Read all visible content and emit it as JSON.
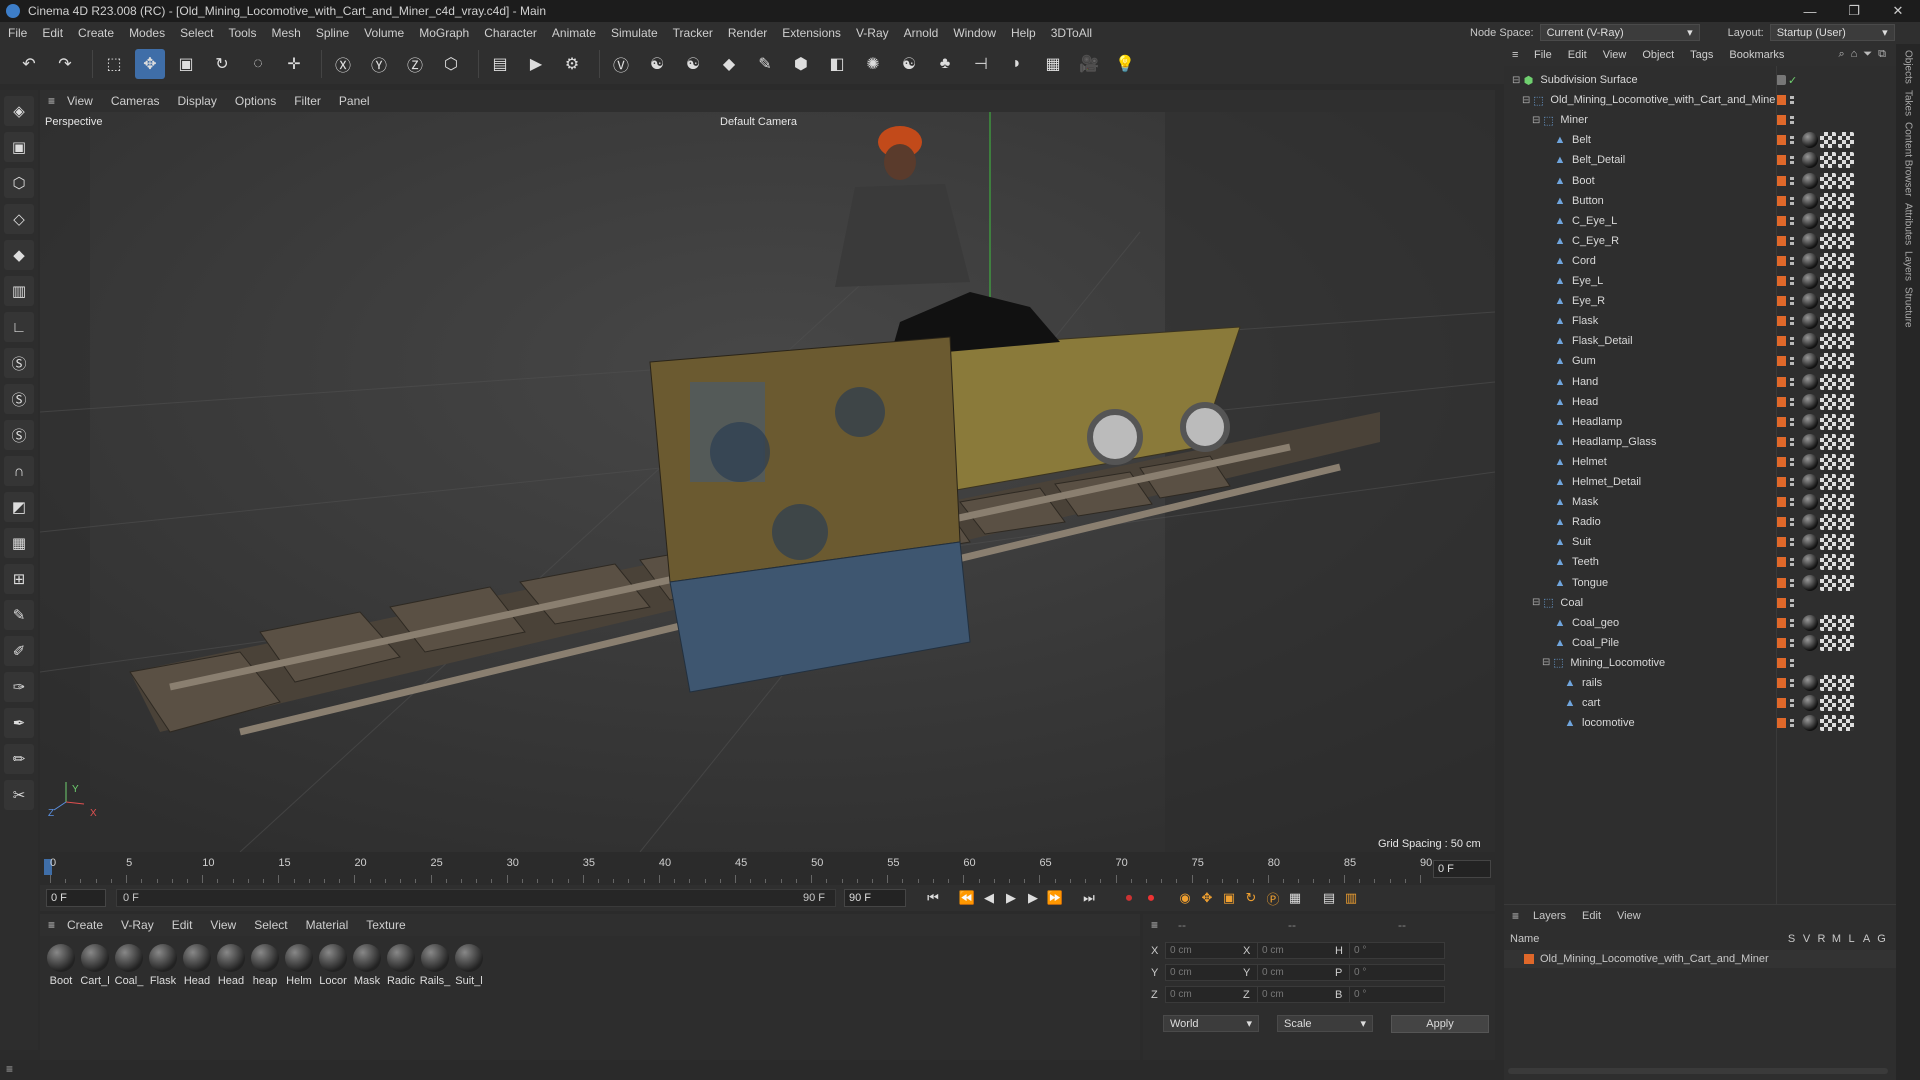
{
  "window": {
    "title": "Cinema 4D R23.008 (RC) - [Old_Mining_Locomotive_with_Cart_and_Miner_c4d_vray.c4d] - Main",
    "controls": [
      "—",
      "❐",
      "✕"
    ]
  },
  "menubar": [
    "File",
    "Edit",
    "Create",
    "Modes",
    "Select",
    "Tools",
    "Mesh",
    "Spline",
    "Volume",
    "MoGraph",
    "Character",
    "Animate",
    "Simulate",
    "Tracker",
    "Render",
    "Extensions",
    "V-Ray",
    "Arnold",
    "Window",
    "Help",
    "3DToAll"
  ],
  "nodespace": {
    "label": "Node Space:",
    "value": "Current (V-Ray)",
    "layout_label": "Layout:",
    "layout_value": "Startup (User)"
  },
  "toolbar": {
    "icons": [
      "undo-icon",
      "redo-icon",
      "select-icon",
      "move-icon",
      "scale-icon",
      "rotate-icon",
      "free-icon",
      "add-icon",
      "x-axis-icon",
      "y-axis-icon",
      "z-axis-icon",
      "coord-icon",
      "render-region-icon",
      "render-view-icon",
      "render-settings-icon",
      "vray-icon",
      "python-icon",
      "python-icon",
      "cube-icon",
      "pen-icon",
      "subdivision-icon",
      "extrude-icon",
      "array-icon",
      "python-icon",
      "mograph-icon",
      "deformer-icon",
      "sweep-icon",
      "floor-icon",
      "camera-icon",
      "light-icon"
    ]
  },
  "viewport": {
    "menu": [
      "View",
      "Cameras",
      "Display",
      "Options",
      "Filter",
      "Panel"
    ],
    "label": "Perspective",
    "camera": "Default Camera",
    "grid_spacing": "Grid Spacing : 50 cm",
    "axes": {
      "x": "X",
      "y": "Y",
      "z": "Z"
    }
  },
  "timeline": {
    "ticks": [
      "0",
      "5",
      "10",
      "15",
      "20",
      "25",
      "30",
      "35",
      "40",
      "45",
      "50",
      "55",
      "60",
      "65",
      "70",
      "75",
      "80",
      "85",
      "90"
    ],
    "end_field": "0 F"
  },
  "transport": {
    "start": "0 F",
    "current": "0 F",
    "end": "90 F",
    "max": "90 F"
  },
  "material_panel": {
    "menu": [
      "Create",
      "V-Ray",
      "Edit",
      "View",
      "Select",
      "Material",
      "Texture"
    ],
    "materials": [
      "Boot",
      "Cart_l",
      "Coal_",
      "Flask",
      "Head",
      "Head",
      "heap",
      "Helm",
      "Locor",
      "Mask",
      "Radic",
      "Rails_",
      "Suit_l"
    ]
  },
  "attributes": {
    "header": [
      "--",
      "--",
      "--"
    ],
    "rows": [
      {
        "l1": "X",
        "v1": "0 cm",
        "l2": "X",
        "v2": "0 cm",
        "l3": "H",
        "v3": "0 °"
      },
      {
        "l1": "Y",
        "v1": "0 cm",
        "l2": "Y",
        "v2": "0 cm",
        "l3": "P",
        "v3": "0 °"
      },
      {
        "l1": "Z",
        "v1": "0 cm",
        "l2": "Z",
        "v2": "0 cm",
        "l3": "B",
        "v3": "0 °"
      }
    ],
    "world": "World",
    "scale": "Scale",
    "apply": "Apply"
  },
  "object_panel": {
    "menu": [
      "File",
      "Edit",
      "View",
      "Object",
      "Tags",
      "Bookmarks"
    ],
    "objects": [
      {
        "name": "Subdivision Surface",
        "indent": 0,
        "kind": "sub"
      },
      {
        "name": "Old_Mining_Locomotive_with_Cart_and_Miner",
        "indent": 1,
        "kind": "null"
      },
      {
        "name": "Miner",
        "indent": 2,
        "kind": "null"
      },
      {
        "name": "Belt",
        "indent": 3,
        "kind": "obj"
      },
      {
        "name": "Belt_Detail",
        "indent": 3,
        "kind": "obj"
      },
      {
        "name": "Boot",
        "indent": 3,
        "kind": "obj"
      },
      {
        "name": "Button",
        "indent": 3,
        "kind": "obj"
      },
      {
        "name": "C_Eye_L",
        "indent": 3,
        "kind": "obj"
      },
      {
        "name": "C_Eye_R",
        "indent": 3,
        "kind": "obj"
      },
      {
        "name": "Cord",
        "indent": 3,
        "kind": "obj"
      },
      {
        "name": "Eye_L",
        "indent": 3,
        "kind": "obj"
      },
      {
        "name": "Eye_R",
        "indent": 3,
        "kind": "obj"
      },
      {
        "name": "Flask",
        "indent": 3,
        "kind": "obj"
      },
      {
        "name": "Flask_Detail",
        "indent": 3,
        "kind": "obj"
      },
      {
        "name": "Gum",
        "indent": 3,
        "kind": "obj"
      },
      {
        "name": "Hand",
        "indent": 3,
        "kind": "obj"
      },
      {
        "name": "Head",
        "indent": 3,
        "kind": "obj"
      },
      {
        "name": "Headlamp",
        "indent": 3,
        "kind": "obj"
      },
      {
        "name": "Headlamp_Glass",
        "indent": 3,
        "kind": "obj"
      },
      {
        "name": "Helmet",
        "indent": 3,
        "kind": "obj"
      },
      {
        "name": "Helmet_Detail",
        "indent": 3,
        "kind": "obj"
      },
      {
        "name": "Mask",
        "indent": 3,
        "kind": "obj"
      },
      {
        "name": "Radio",
        "indent": 3,
        "kind": "obj"
      },
      {
        "name": "Suit",
        "indent": 3,
        "kind": "obj"
      },
      {
        "name": "Teeth",
        "indent": 3,
        "kind": "obj"
      },
      {
        "name": "Tongue",
        "indent": 3,
        "kind": "obj"
      },
      {
        "name": "Coal",
        "indent": 2,
        "kind": "null"
      },
      {
        "name": "Coal_geo",
        "indent": 3,
        "kind": "obj"
      },
      {
        "name": "Coal_Pile",
        "indent": 3,
        "kind": "obj"
      },
      {
        "name": "Mining_Locomotive",
        "indent": 3,
        "kind": "null"
      },
      {
        "name": "rails",
        "indent": 4,
        "kind": "obj"
      },
      {
        "name": "cart",
        "indent": 4,
        "kind": "obj"
      },
      {
        "name": "locomotive",
        "indent": 4,
        "kind": "obj"
      }
    ]
  },
  "layers_panel": {
    "menu": [
      "Layers",
      "Edit",
      "View"
    ],
    "name_header": "Name",
    "cols": [
      "S",
      "V",
      "R",
      "M",
      "L",
      "A",
      "G"
    ],
    "layer": "Old_Mining_Locomotive_with_Cart_and_Miner"
  },
  "right_tabs": [
    "Objects",
    "Takes",
    "Content Browser",
    "Attributes",
    "Layers",
    "Structure"
  ],
  "colors": {
    "accent": "#3f6ea8",
    "tag": "#e0682a",
    "viewport_bg": "#3a3a3a"
  }
}
